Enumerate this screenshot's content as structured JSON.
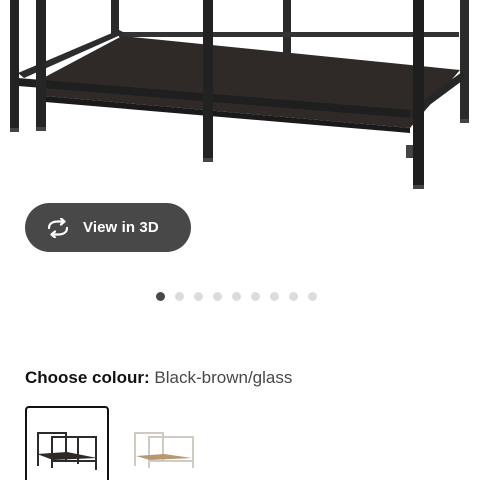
{
  "product": {
    "image_alt": "Nesting tables, black-brown/glass"
  },
  "view_3d": {
    "label": "View in 3D",
    "icon": "rotate-3d-icon",
    "bg_color": "#484848"
  },
  "carousel": {
    "total": 9,
    "active_index": 0
  },
  "colour": {
    "key_label": "Choose colour:",
    "selected_value": "Black-brown/glass",
    "options": [
      {
        "name": "Black-brown/glass",
        "selected": true,
        "frame_color": "#2b2b2b",
        "shelf_color": "#2e2a27"
      },
      {
        "name": "White/oak",
        "selected": false,
        "frame_color": "#cfcac2",
        "shelf_color": "#b89870"
      }
    ]
  }
}
